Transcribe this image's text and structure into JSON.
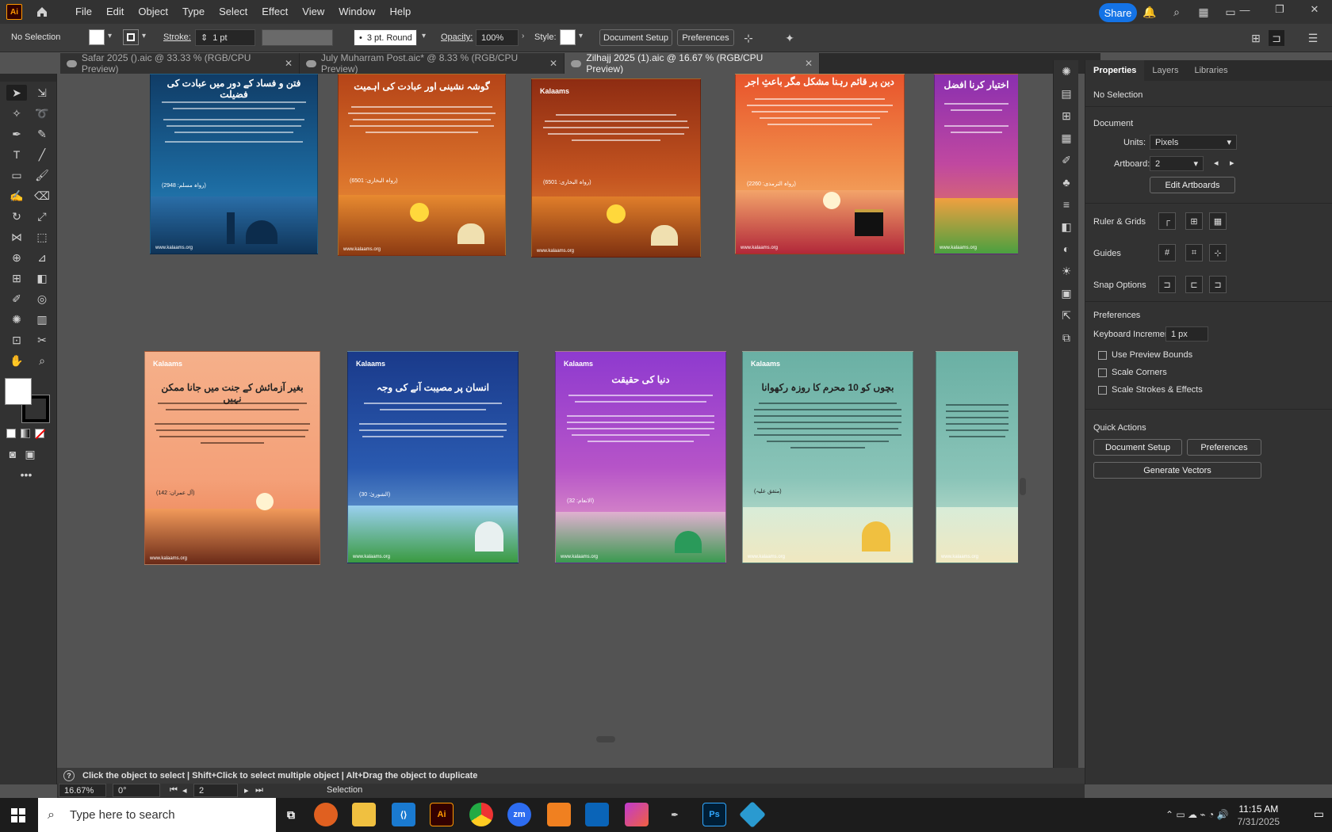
{
  "app": {
    "logo": "Ai",
    "share_label": "Share"
  },
  "menu": [
    "File",
    "Edit",
    "Object",
    "Type",
    "Select",
    "Effect",
    "View",
    "Window",
    "Help"
  ],
  "control_bar": {
    "selection": "No Selection",
    "stroke_label": "Stroke:",
    "stroke_value": "1 pt",
    "brush_value": "3 pt. Round",
    "opacity_label": "Opacity:",
    "opacity_value": "100%",
    "style_label": "Style:",
    "document_setup": "Document Setup",
    "preferences": "Preferences"
  },
  "tabs": [
    {
      "label": "Safar 2025 ().aic @ 33.33 % (RGB/CPU Preview)"
    },
    {
      "label": "July Muharram Post.aic* @ 8.33 % (RGB/CPU Preview)"
    },
    {
      "label": "Zilhajj 2025 (1).aic @ 16.67 % (RGB/CPU Preview)"
    }
  ],
  "artboards": [
    {
      "title": "فتن و فساد کے دور میں عبادت کی فضیلت",
      "ref": "(رواہ مسلم: 2948)",
      "footer": "www.kalaams.org"
    },
    {
      "title": "گوشہ نشینی اور عبادت کی اہمیت",
      "ref": "(رواہ البخاری: 6501)",
      "footer": "www.kalaams.org"
    },
    {
      "logo": "Kalaams",
      "ref": "(رواہ البخاری: 6501)",
      "footer": "www.kalaams.org"
    },
    {
      "title": "دین پر قائم رہنا مشکل مگر باعثِ اجر",
      "ref": "(رواہ الترمذی: 2260)",
      "footer": "www.kalaams.org"
    },
    {
      "title": "اختیار کرنا افضل",
      "footer": "www.kalaams.org"
    },
    {
      "logo": "Kalaams",
      "title": "بغیر آزمائش کے جنت میں جانا ممکن نہیں",
      "ref": "(آل عمران: 142)",
      "footer": "www.kalaams.org"
    },
    {
      "logo": "Kalaams",
      "title": "انسان پر مصیبت آنے کی وجہ",
      "ref": "(الشوریٰ: 30)",
      "footer": "www.kalaams.org"
    },
    {
      "logo": "Kalaams",
      "title": "دنیا کی حقیقت",
      "ref": "(الانعام: 32)",
      "footer": "www.kalaams.org"
    },
    {
      "logo": "Kalaams",
      "title": "بچوں کو 10 محرم کا روزہ رکھوانا",
      "ref": "(متفق علیہ)",
      "footer": "www.kalaams.org"
    },
    {
      "footer": "www.kalaams.org"
    }
  ],
  "properties": {
    "tabs": [
      "Properties",
      "Layers",
      "Libraries"
    ],
    "selection": "No Selection",
    "document": "Document",
    "units_label": "Units:",
    "units_value": "Pixels",
    "artboard_label": "Artboard:",
    "artboard_value": "2",
    "edit_artboards": "Edit Artboards",
    "ruler_grids": "Ruler & Grids",
    "guides": "Guides",
    "snap_options": "Snap Options",
    "preferences": "Preferences",
    "keyboard_increment_label": "Keyboard Increment:",
    "keyboard_increment_value": "1 px",
    "check_preview_bounds": "Use Preview Bounds",
    "check_scale_corners": "Scale Corners",
    "check_scale_strokes": "Scale Strokes & Effects",
    "quick_actions": "Quick Actions",
    "btn_document_setup": "Document Setup",
    "btn_preferences": "Preferences",
    "btn_generate_vectors": "Generate Vectors"
  },
  "hint": "Click the object to select  |  Shift+Click to select multiple object  |  Alt+Drag the object to duplicate",
  "status": {
    "zoom": "16.67%",
    "rotation": "0°",
    "artboard": "2",
    "mode": "Selection"
  },
  "taskbar": {
    "search_placeholder": "Type here to search",
    "time": "11:15 AM",
    "date": "7/31/2025"
  }
}
